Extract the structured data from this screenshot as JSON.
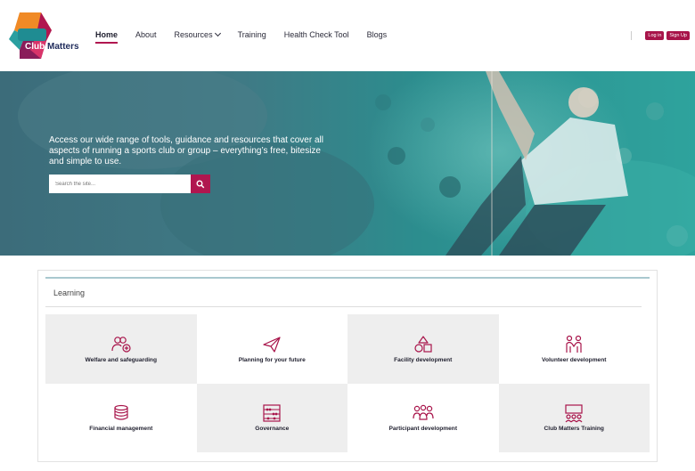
{
  "brand": {
    "logo_text_a": "Club",
    "logo_text_b": "Matters",
    "accent": "#b0164f",
    "navy": "#1e2a5a",
    "teal": "#2ea39d"
  },
  "nav": {
    "items": [
      {
        "label": "Home",
        "active": true
      },
      {
        "label": "About"
      },
      {
        "label": "Resources",
        "dropdown": true
      },
      {
        "label": "Training"
      },
      {
        "label": "Health Check Tool"
      },
      {
        "label": "Blogs"
      }
    ],
    "login_label": "Log in",
    "signup_label": "Sign Up"
  },
  "hero": {
    "text": "Access our wide range of tools, guidance and resources that cover all aspects of running a sports club or group – everything’s free, bitesize and simple to use.",
    "search_placeholder": "Search the site..."
  },
  "learning": {
    "title": "Learning",
    "tiles": [
      {
        "label": "Welfare and safeguarding",
        "icon": "people-plus-icon"
      },
      {
        "label": "Planning for your future",
        "icon": "paper-plane-icon"
      },
      {
        "label": "Facility development",
        "icon": "shapes-icon"
      },
      {
        "label": "Volunteer development",
        "icon": "volunteers-icon"
      },
      {
        "label": "Financial management",
        "icon": "coins-stack-icon"
      },
      {
        "label": "Governance",
        "icon": "abacus-icon"
      },
      {
        "label": "Participant development",
        "icon": "group-icon"
      },
      {
        "label": "Club Matters Training",
        "icon": "presentation-icon"
      }
    ]
  }
}
